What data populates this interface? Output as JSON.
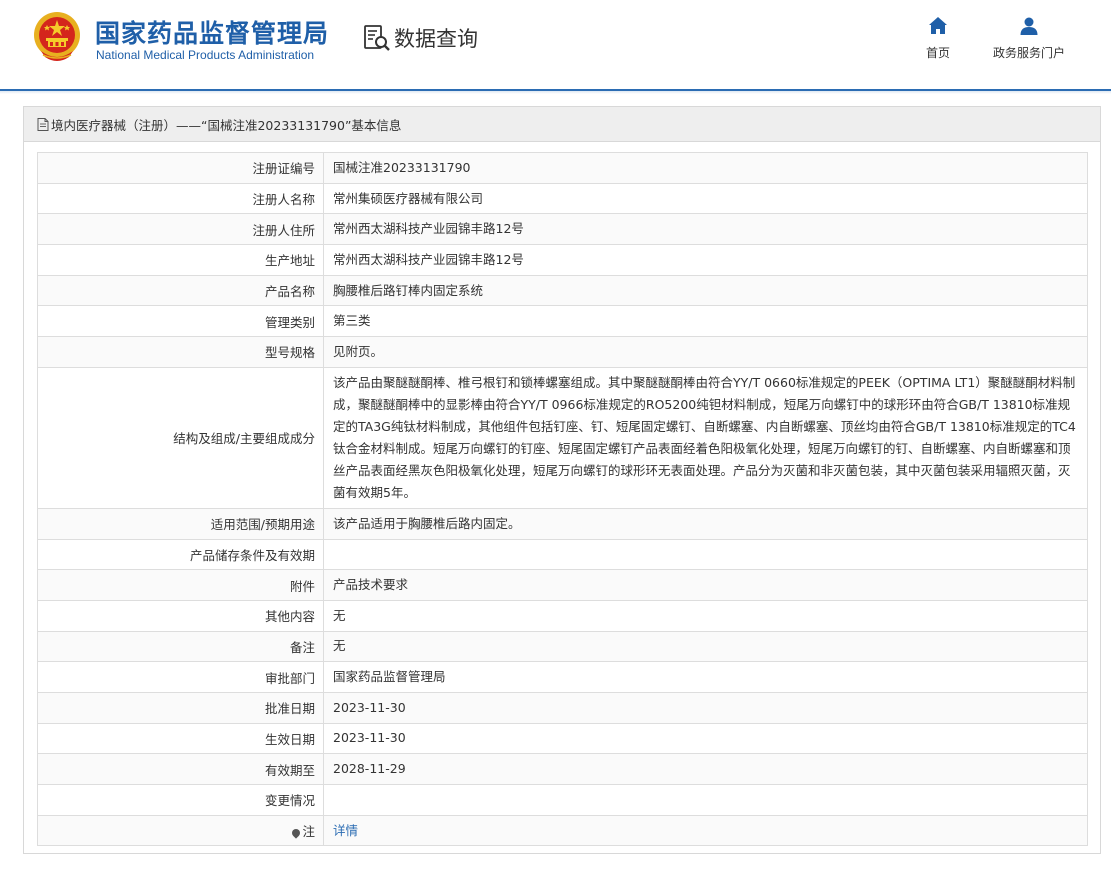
{
  "header": {
    "brand_cn": "国家药品监督管理局",
    "brand_en": "National Medical Products Administration",
    "module_title": "数据查询",
    "nav": [
      {
        "label": "首页",
        "icon": "home-icon"
      },
      {
        "label": "政务服务门户",
        "icon": "user-icon"
      }
    ]
  },
  "colors": {
    "brand_blue": "#1f5fa8",
    "link": "#2b6cb3",
    "accent_line": "#2b6cb3"
  },
  "panel": {
    "title": "境内医疗器械（注册）——“国械注准20233131790”基本信息"
  },
  "rows": [
    {
      "key": "注册证编号",
      "value": "国械注准20233131790"
    },
    {
      "key": "注册人名称",
      "value": "常州集硕医疗器械有限公司"
    },
    {
      "key": "注册人住所",
      "value": "常州西太湖科技产业园锦丰路12号"
    },
    {
      "key": "生产地址",
      "value": "常州西太湖科技产业园锦丰路12号"
    },
    {
      "key": "产品名称",
      "value": "胸腰椎后路钉棒内固定系统"
    },
    {
      "key": "管理类别",
      "value": "第三类"
    },
    {
      "key": "型号规格",
      "value": "见附页。"
    },
    {
      "key": "结构及组成/主要组成成分",
      "value": "该产品由聚醚醚酮棒、椎弓根钉和锁棒螺塞组成。其中聚醚醚酮棒由符合YY/T 0660标准规定的PEEK（OPTIMA LT1）聚醚醚酮材料制成，聚醚醚酮棒中的显影棒由符合YY/T 0966标准规定的RO5200纯钽材料制成，短尾万向螺钉中的球形环由符合GB/T 13810标准规定的TA3G纯钛材料制成，其他组件包括钉座、钉、短尾固定螺钉、自断螺塞、内自断螺塞、顶丝均由符合GB/T 13810标准规定的TC4钛合金材料制成。短尾万向螺钉的钉座、短尾固定螺钉产品表面经着色阳极氧化处理，短尾万向螺钉的钉、自断螺塞、内自断螺塞和顶丝产品表面经黑灰色阳极氧化处理，短尾万向螺钉的球形环无表面处理。产品分为灭菌和非灭菌包装，其中灭菌包装采用辐照灭菌，灭菌有效期5年。"
    },
    {
      "key": "适用范围/预期用途",
      "value": "该产品适用于胸腰椎后路内固定。"
    },
    {
      "key": "产品储存条件及有效期",
      "value": ""
    },
    {
      "key": "附件",
      "value": "产品技术要求"
    },
    {
      "key": "其他内容",
      "value": "无"
    },
    {
      "key": "备注",
      "value": "无"
    },
    {
      "key": "审批部门",
      "value": "国家药品监督管理局"
    },
    {
      "key": "批准日期",
      "value": "2023-11-30"
    },
    {
      "key": "生效日期",
      "value": "2023-11-30"
    },
    {
      "key": "有效期至",
      "value": "2028-11-29"
    },
    {
      "key": "变更情况",
      "value": ""
    },
    {
      "key": "注",
      "value": "详情",
      "link": true
    }
  ]
}
